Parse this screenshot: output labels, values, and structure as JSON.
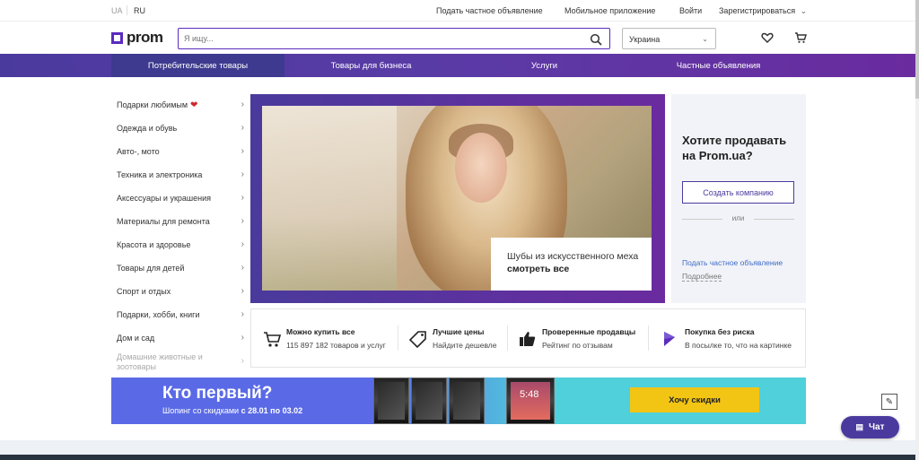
{
  "topbar": {
    "lang_ua": "UA",
    "lang_ru": "RU",
    "post_ad": "Подать частное объявление",
    "mobile_app": "Мобильное приложение",
    "login": "Войти",
    "register": "Зарегистрироваться"
  },
  "header": {
    "logo": "prom",
    "search_placeholder": "Я ищу...",
    "region": "Украина"
  },
  "nav": [
    {
      "label": "Потребительские товары"
    },
    {
      "label": "Товары для бизнеса"
    },
    {
      "label": "Услуги"
    },
    {
      "label": "Частные объявления"
    }
  ],
  "categories": [
    {
      "label": "Подарки любимым"
    },
    {
      "label": "Одежда и обувь"
    },
    {
      "label": "Авто-, мото"
    },
    {
      "label": "Техника и электроника"
    },
    {
      "label": "Аксессуары и украшения"
    },
    {
      "label": "Материалы для ремонта"
    },
    {
      "label": "Красота и здоровье"
    },
    {
      "label": "Товары для детей"
    },
    {
      "label": "Спорт и отдых"
    },
    {
      "label": "Подарки, хобби, книги"
    },
    {
      "label": "Дом и сад"
    },
    {
      "label": "Домашние животные и зоотовары"
    }
  ],
  "banner": {
    "caption_line1": "Шубы из искусственного меха",
    "caption_line2": "смотреть все"
  },
  "sell": {
    "title": "Хотите продавать на Prom.ua?",
    "create_button": "Создать компанию",
    "or": "или",
    "post_ad_link": "Подать частное объявление",
    "more": "Подробнее"
  },
  "features": [
    {
      "title": "Можно купить все",
      "text": "115 897 182 товаров и услуг",
      "icon": "cart-icon"
    },
    {
      "title": "Лучшие цены",
      "text": "Найдите дешевле",
      "icon": "price-tag-icon"
    },
    {
      "title": "Проверенные продавцы",
      "text": "Рейтинг по отзывам",
      "icon": "thumbs-up-icon"
    },
    {
      "title": "Покупка без риска",
      "text": "В посылке то, что на картинке",
      "icon": "shield-icon"
    }
  ],
  "promo": {
    "title": "Кто первый?",
    "sub_prefix": "Шопинг со скидками",
    "sub_dates": "с 28.01 по 03.02",
    "phone_time": "5:48",
    "button": "Хочу скидки"
  },
  "chat": {
    "label": "Чат"
  },
  "colors": {
    "brand": "#5b2bbf",
    "nav_start": "#4b3a9e",
    "nav_end": "#6a2b9f",
    "promo_button": "#f2c515"
  }
}
